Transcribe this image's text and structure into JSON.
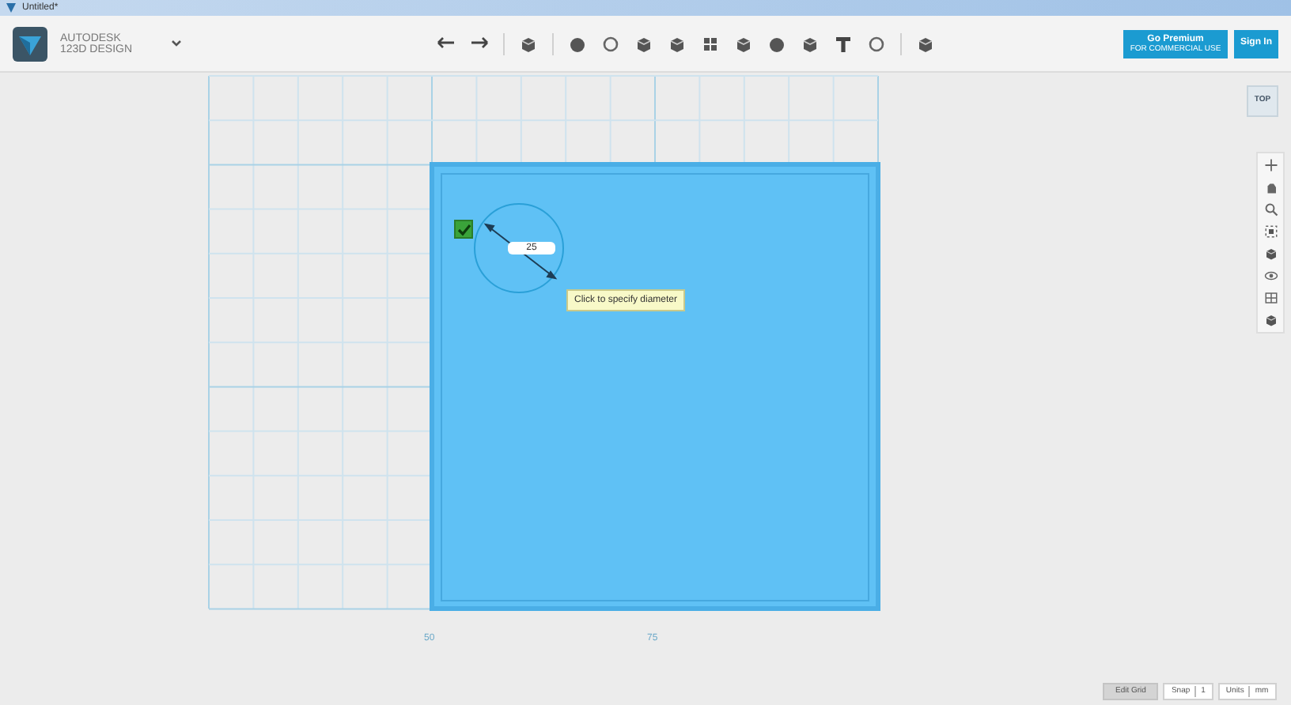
{
  "window": {
    "title": "Untitled*"
  },
  "brand": {
    "line_1": "AUTODESK",
    "line_2": "123D DESIGN"
  },
  "header_buttons": [
    {
      "kind": "premium",
      "label": "Go Premium",
      "sublabel": "FOR COMMERCIAL USE"
    },
    {
      "kind": "plain",
      "label": "Sign In"
    }
  ],
  "view_cube": {
    "label": "TOP"
  },
  "sketch": {
    "confirm_checked": true,
    "diameter_value": "25",
    "tooltip": "Click to specify diameter"
  },
  "grid_labels": [
    "50",
    "75"
  ],
  "status_bar": {
    "edit_grid": "Edit Grid",
    "snap_label": "Snap",
    "snap_value": "1",
    "units_label": "Units",
    "units_value": "mm"
  }
}
